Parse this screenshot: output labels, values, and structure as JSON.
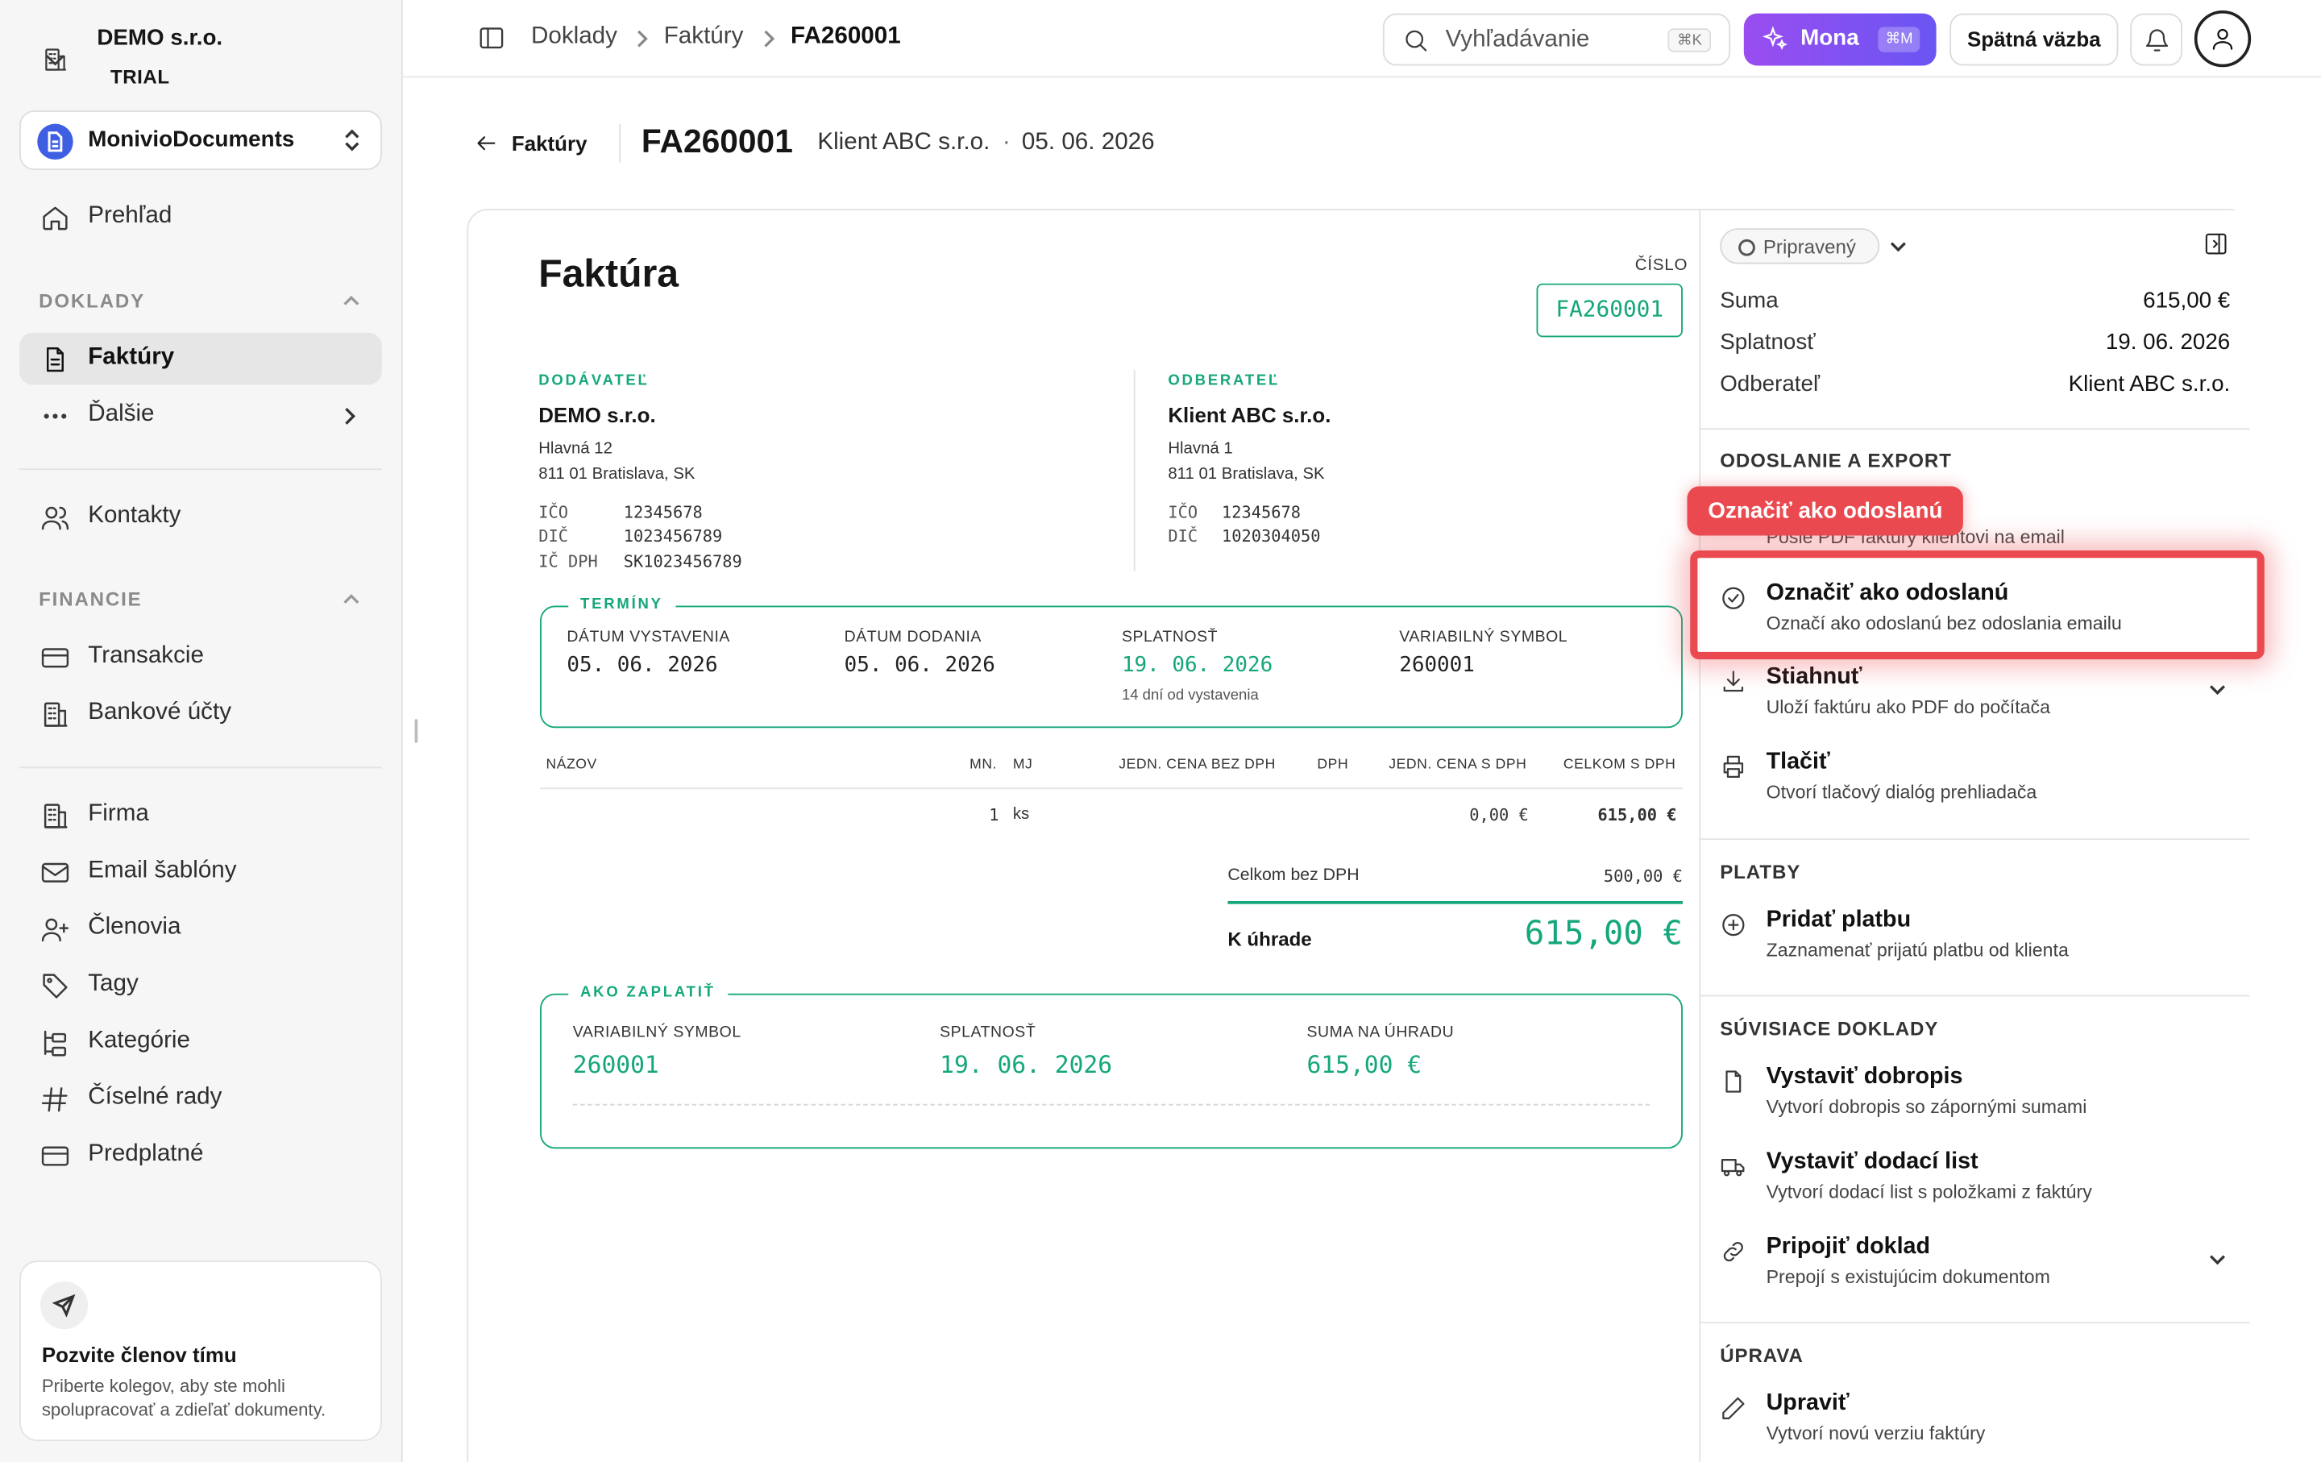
{
  "sidebar": {
    "org_name": "DEMO s.r.o.",
    "org_plan": "TRIAL",
    "workspace": "MonivioDocuments",
    "nav_overview": "Prehľad",
    "section_doklady": "DOKLADY",
    "nav_invoices": "Faktúry",
    "nav_more": "Ďalšie",
    "nav_contacts": "Kontakty",
    "section_financie": "FINANCIE",
    "nav_transactions": "Transakcie",
    "nav_bank_accounts": "Bankové účty",
    "nav_company": "Firma",
    "nav_email_templates": "Email šablóny",
    "nav_members": "Členovia",
    "nav_tags": "Tagy",
    "nav_categories": "Kategórie",
    "nav_number_series": "Číselné rady",
    "nav_subscription": "Predplatné",
    "invite_title": "Pozvite členov tímu",
    "invite_text": "Priberte kolegov, aby ste mohli spolupracovať a zdieľať dokumenty."
  },
  "topbar": {
    "breadcrumb": [
      "Doklady",
      "Faktúry",
      "FA260001"
    ],
    "search_placeholder": "Vyhľadávanie",
    "search_shortcut": "⌘K",
    "mona_label": "Mona",
    "mona_shortcut": "⌘M",
    "feedback_label": "Spätná väzba"
  },
  "header": {
    "back_label": "Faktúry",
    "doc_number": "FA260001",
    "client": "Klient ABC s.r.o.",
    "separator": "·",
    "date": "05. 06. 2026"
  },
  "invoice": {
    "title": "Faktúra",
    "number_label": "ČÍSLO",
    "number": "FA260001",
    "supplier": {
      "label": "DODÁVATEĽ",
      "name": "DEMO s.r.o.",
      "street": "Hlavná 12",
      "city": "811 01 Bratislava, SK",
      "ids": [
        {
          "k": "IČO",
          "v": "12345678"
        },
        {
          "k": "DIČ",
          "v": "1023456789"
        },
        {
          "k": "IČ DPH",
          "v": "SK1023456789"
        }
      ]
    },
    "customer": {
      "label": "ODBERATEĽ",
      "name": "Klient ABC s.r.o.",
      "street": "Hlavná 1",
      "city": "811 01 Bratislava, SK",
      "ids": [
        {
          "k": "IČO",
          "v": "12345678"
        },
        {
          "k": "DIČ",
          "v": "1020304050"
        }
      ]
    },
    "terms": {
      "label": "TERMÍNY",
      "issue_label": "DÁTUM VYSTAVENIA",
      "issue": "05. 06. 2026",
      "delivery_label": "DÁTUM DODANIA",
      "delivery": "05. 06. 2026",
      "due_label": "SPLATNOSŤ",
      "due": "19. 06. 2026",
      "due_note": "14 dní od vystavenia",
      "vs_label": "VARIABILNÝ SYMBOL",
      "vs": "260001"
    },
    "table": {
      "headers": [
        "NÁZOV",
        "MN.",
        "MJ",
        "JEDN. CENA BEZ DPH",
        "DPH",
        "JEDN. CENA S DPH",
        "CELKOM S DPH"
      ],
      "rows": [
        {
          "name": "",
          "qty": "1",
          "unit": "ks",
          "price_ex": "",
          "vat": "",
          "price_inc": "0,00 €",
          "total": "615,00 €"
        }
      ]
    },
    "subtotal_label": "Celkom bez DPH",
    "subtotal": "500,00 €",
    "due_total_label": "K úhrade",
    "due_total": "615,00 €",
    "pay": {
      "label": "AKO ZAPLATIŤ",
      "vs_label": "VARIABILNÝ SYMBOL",
      "vs": "260001",
      "due_label": "SPLATNOSŤ",
      "due": "19. 06. 2026",
      "amount_label": "SUMA NA ÚHRADU",
      "amount": "615,00 €"
    }
  },
  "panel": {
    "status": "Pripravený",
    "summary": [
      {
        "k": "Suma",
        "v": "615,00 €"
      },
      {
        "k": "Splatnosť",
        "v": "19. 06. 2026"
      },
      {
        "k": "Odberateľ",
        "v": "Klient ABC s.r.o."
      }
    ],
    "sections": {
      "send_export": "ODOSLANIE A EXPORT",
      "payments": "PLATBY",
      "related": "SÚVISIACE DOKLADY",
      "edit": "ÚPRAVA"
    },
    "send_email_sub": "Pošle PDF faktúry klientovi na email",
    "mark_sent": {
      "t": "Označiť ako odoslanú",
      "s": "Označí ako odoslanú bez odoslania emailu"
    },
    "download": {
      "t": "Stiahnuť",
      "s": "Uloží faktúru ako PDF do počítača"
    },
    "print": {
      "t": "Tlačiť",
      "s": "Otvorí tlačový dialóg prehliadača"
    },
    "add_payment": {
      "t": "Pridať platbu",
      "s": "Zaznamenať prijatú platbu od klienta"
    },
    "credit_note": {
      "t": "Vystaviť dobropis",
      "s": "Vytvorí dobropis so zápornými sumami"
    },
    "delivery_note": {
      "t": "Vystaviť dodací list",
      "s": "Vytvorí dodací list s položkami z faktúry"
    },
    "link_doc": {
      "t": "Pripojiť doklad",
      "s": "Prepojí s existujúcim dokumentom"
    },
    "edit_doc": {
      "t": "Upraviť",
      "s": "Vytvorí novú verziu faktúry"
    }
  },
  "highlight_tooltip": "Označiť ako odoslanú",
  "colors": {
    "accent_green": "#15a77b",
    "highlight_red": "#ea4a4f",
    "mona_purple": "#8a4ff0",
    "workspace_blue": "#3f5fe3"
  }
}
